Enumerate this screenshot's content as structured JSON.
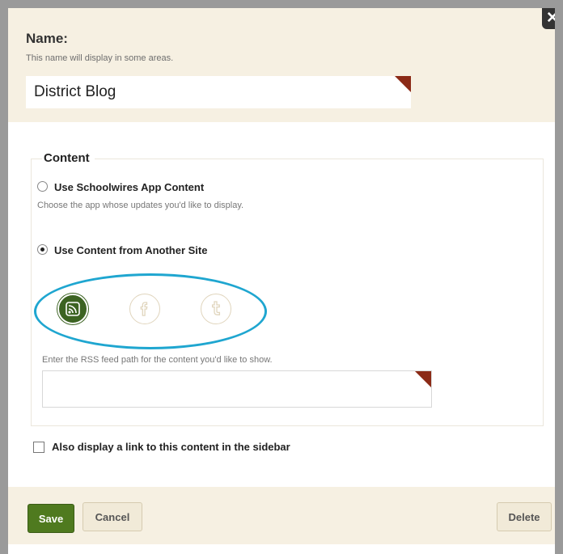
{
  "dialog": {
    "close_label": "✕"
  },
  "name_section": {
    "title": "Name:",
    "help": "This name will display in some areas.",
    "value": "District Blog"
  },
  "content": {
    "legend": "Content",
    "option_app": {
      "label": "Use Schoolwires App Content",
      "help": "Choose the app whose updates you'd like to display.",
      "selected": false
    },
    "option_other_site": {
      "label": "Use Content from Another Site",
      "selected": true
    },
    "sources": [
      {
        "name": "rss-icon",
        "active": true
      },
      {
        "name": "facebook-icon",
        "active": false
      },
      {
        "name": "tumblr-icon",
        "active": false
      }
    ],
    "rss_help": "Enter the RSS feed path for the content you'd like to show.",
    "rss_value": ""
  },
  "sidebar_checkbox": {
    "label": "Also display a link to this content in the sidebar",
    "checked": false
  },
  "footer": {
    "save_label": "Save",
    "cancel_label": "Cancel",
    "delete_label": "Delete"
  },
  "colors": {
    "accent_green": "#4f7a1f",
    "section_bg": "#f6f0e2",
    "highlight_ring": "#1fa6d0",
    "required_flag": "#8b2a16"
  }
}
